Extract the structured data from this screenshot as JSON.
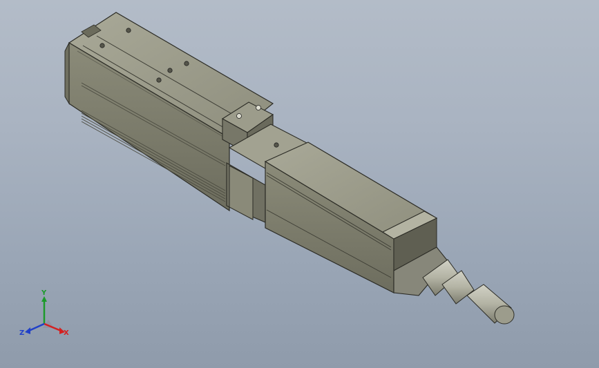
{
  "viewport": {
    "background_top": "#b3bcc8",
    "background_bottom": "#8f9bab"
  },
  "model": {
    "body_color": "#8a8a78",
    "edge_color": "#2b2b25",
    "cable_color": "#b5b5a6"
  },
  "triad": {
    "x_label": "X",
    "y_label": "Y",
    "z_label": "Z",
    "x_color": "#d42020",
    "y_color": "#1c9a2a",
    "z_color": "#2040c8"
  }
}
